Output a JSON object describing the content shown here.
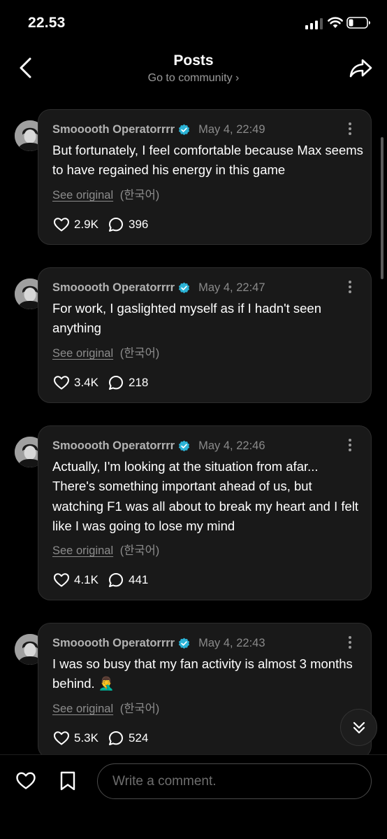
{
  "status_bar": {
    "time": "22.53"
  },
  "header": {
    "title": "Posts",
    "subtitle": "Go to community",
    "subtitle_chevron": "›"
  },
  "posts": [
    {
      "author": "Smooooth Operatorrrr",
      "time": "May 4, 22:49",
      "text": "But fortunately, I feel comfortable because Max seems to have regained his energy in this game",
      "see_original": "See original",
      "language": "(한국어)",
      "likes": "2.9K",
      "comments": "396"
    },
    {
      "author": "Smooooth Operatorrrr",
      "time": "May 4, 22:47",
      "text": "For work, I gaslighted myself as if I hadn't seen anything",
      "see_original": "See original",
      "language": "(한국어)",
      "likes": "3.4K",
      "comments": "218"
    },
    {
      "author": "Smooooth Operatorrrr",
      "time": "May 4, 22:46",
      "text": "Actually, I'm looking at the situation from afar... There's something important ahead of us, but watching F1 was all about to break my heart and I felt like I was going to lose my mind",
      "see_original": "See original",
      "language": "(한국어)",
      "likes": "4.1K",
      "comments": "441"
    },
    {
      "author": "Smooooth Operatorrrr",
      "time": "May 4, 22:43",
      "text": "I was so busy that my fan activity is almost 3 months behind. 🤦‍♂️",
      "see_original": "See original",
      "language": "(한국어)",
      "likes": "5.3K",
      "comments": "524"
    }
  ],
  "comment_bar": {
    "placeholder": "Write a comment."
  },
  "icons": {
    "back": "chevron-left-icon",
    "share": "share-arrow-icon",
    "verified": "verified-badge-icon",
    "like": "heart-icon",
    "comment": "comment-bubble-icon",
    "more": "more-vertical-icon",
    "scroll_down": "double-chevron-down-icon",
    "save": "bookmark-icon"
  },
  "colors": {
    "background": "#000000",
    "card": "#191919",
    "verified": "#2bb3d6",
    "muted": "#8c8c8c"
  }
}
